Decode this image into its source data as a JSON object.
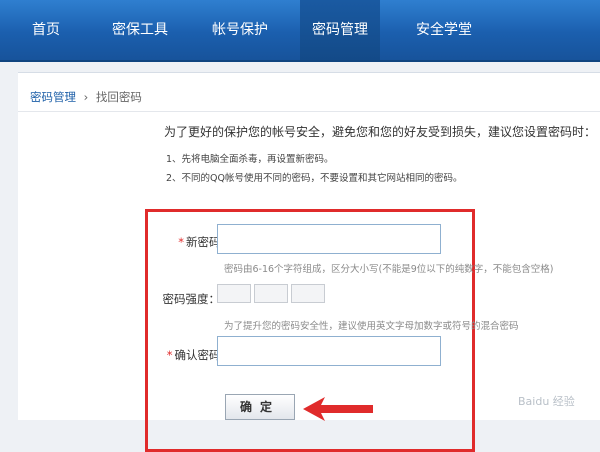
{
  "nav": {
    "items": [
      {
        "label": "首页"
      },
      {
        "label": "密保工具"
      },
      {
        "label": "帐号保护"
      },
      {
        "label": "密码管理"
      },
      {
        "label": "安全学堂"
      }
    ],
    "active_index": 3
  },
  "breadcrumb": {
    "parent": "密码管理",
    "separator": "›",
    "current": "找回密码"
  },
  "intro": "为了更好的保护您的帐号安全，避免您和您的好友受到损失，建议您设置密码时：",
  "tips": [
    "1、先将电脑全面杀毒，再设置新密码。",
    "2、不同的QQ帐号使用不同的密码，不要设置和其它网站相同的密码。"
  ],
  "form": {
    "required_mark": "*",
    "new_password": {
      "label": "新密码：",
      "hint": "密码由6-16个字符组成，区分大小写(不能是9位以下的纯数字，不能包含空格)"
    },
    "strength": {
      "label": "密码强度：",
      "hint": "为了提升您的密码安全性，建议使用英文字母加数字或符号的混合密码"
    },
    "confirm_password": {
      "label": "确认密码："
    },
    "submit_label": "确定"
  },
  "watermark": "Baidu 经验",
  "colors": {
    "nav_bg": "#1b5fae",
    "highlight_box": "#e02b2b",
    "link": "#1d5fa8"
  }
}
